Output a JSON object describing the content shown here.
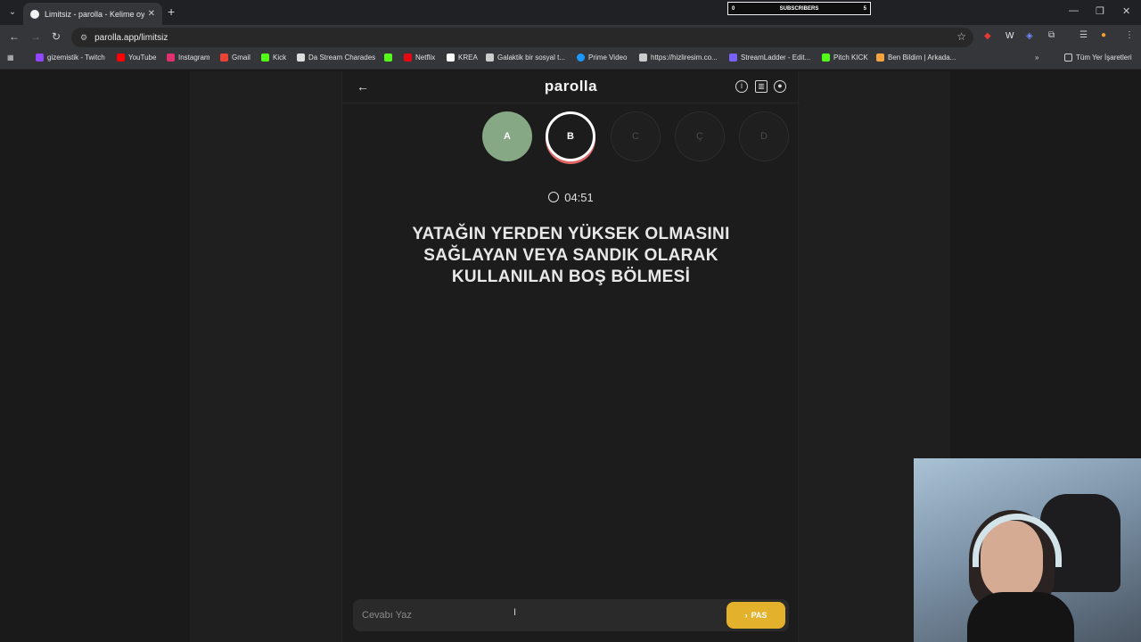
{
  "browser": {
    "tab_title": "Limitsiz - parolla - Kelime oyunu",
    "url": "parolla.app/limitsiz",
    "subscribers": {
      "label": "SUBSCRIBERS",
      "left": "0",
      "right": "5"
    },
    "bookmarks": [
      {
        "label": "gizemistik - Twitch",
        "color": "#9146ff"
      },
      {
        "label": "YouTube",
        "color": "#ff0000"
      },
      {
        "label": "Instagram",
        "color": "#e1306c"
      },
      {
        "label": "Gmail",
        "color": "#ea4335"
      },
      {
        "label": "Kick",
        "color": "#53fc18"
      },
      {
        "label": "Da Stream Charades",
        "color": "#dddddd"
      },
      {
        "label": "",
        "color": "#53fc18"
      },
      {
        "label": "Netflix",
        "color": "#e50914"
      },
      {
        "label": "KREA",
        "color": "#ffffff"
      },
      {
        "label": "Galaktik bir sosyal t...",
        "color": "#cccccc"
      },
      {
        "label": "Prime Video",
        "color": "#1a98ff"
      },
      {
        "label": "https://hizliresim.co...",
        "color": "#cccccc"
      },
      {
        "label": "StreamLadder - Edit...",
        "color": "#7b61ff"
      },
      {
        "label": "Pitch KICK",
        "color": "#53fc18"
      },
      {
        "label": "Ben Bildim | Arkada...",
        "color": "#f4a340"
      }
    ],
    "all_bookmarks_label": "Tüm Yer İşaretleri"
  },
  "app": {
    "logo": "parolla",
    "letters": [
      {
        "letter": "A",
        "state": "done"
      },
      {
        "letter": "B",
        "state": "active"
      },
      {
        "letter": "C",
        "state": "pending"
      },
      {
        "letter": "Ç",
        "state": "pending"
      },
      {
        "letter": "D",
        "state": "pending"
      }
    ],
    "timer": "04:51",
    "question_lines": [
      "YATAĞIN YERDEN YÜKSEK OLMASINI",
      "SAĞLAYAN VEYA SANDIK OLARAK",
      "KULLANILAN BOŞ BÖLMESİ"
    ],
    "answer_placeholder": "Cevabı Yaz",
    "pass_label": "PAS"
  }
}
